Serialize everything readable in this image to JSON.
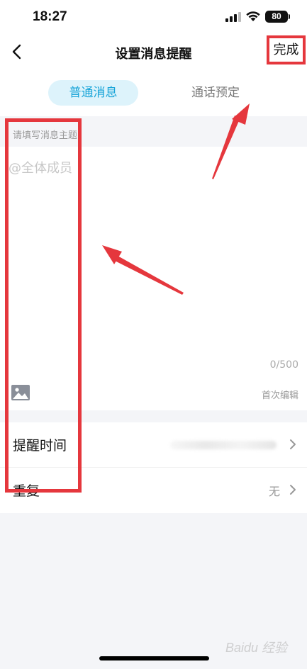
{
  "status_bar": {
    "time": "18:27",
    "battery": "80"
  },
  "nav": {
    "title": "设置消息提醒",
    "done_label": "完成"
  },
  "tabs": [
    {
      "label": "普通消息",
      "active": true
    },
    {
      "label": "通话预定",
      "active": false
    }
  ],
  "subject": {
    "placeholder": "请填写消息主题"
  },
  "message": {
    "placeholder": "@全体成员",
    "counter": "0/500",
    "edit_status": "首次编辑"
  },
  "settings": [
    {
      "label": "提醒时间",
      "value": ""
    },
    {
      "label": "重复",
      "value": "无"
    }
  ],
  "watermark": "Baidu 经验",
  "colors": {
    "accent": "#17a4d8",
    "annotation": "#e5373d"
  }
}
